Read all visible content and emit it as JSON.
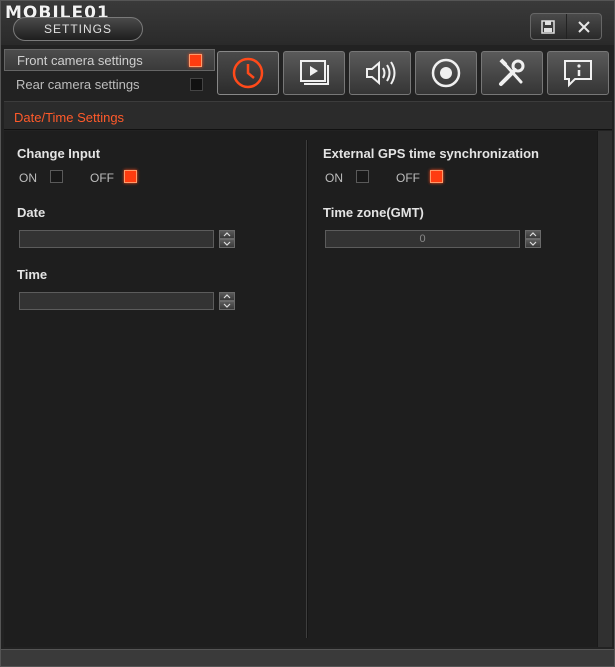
{
  "app": {
    "logo_text": "MOBILE01",
    "title": "SETTINGS"
  },
  "window_buttons": {
    "save_icon": "save-icon",
    "close_icon": "close-icon"
  },
  "cameras": [
    {
      "label": "Front camera settings",
      "selected": true
    },
    {
      "label": "Rear camera settings",
      "selected": false
    }
  ],
  "tabs": [
    {
      "icon": "clock-icon",
      "active": true
    },
    {
      "icon": "video-playback-icon",
      "active": false
    },
    {
      "icon": "speaker-icon",
      "active": false
    },
    {
      "icon": "record-icon",
      "active": false
    },
    {
      "icon": "tools-icon",
      "active": false
    },
    {
      "icon": "info-icon",
      "active": false
    }
  ],
  "section": {
    "title": "Date/Time Settings"
  },
  "left": {
    "change_input": {
      "label": "Change Input",
      "on_label": "ON",
      "off_label": "OFF",
      "value": "OFF"
    },
    "date": {
      "label": "Date",
      "value": ""
    },
    "time": {
      "label": "Time",
      "value": ""
    }
  },
  "right": {
    "gps_sync": {
      "label": "External GPS time synchronization",
      "on_label": "ON",
      "off_label": "OFF",
      "value": "OFF"
    },
    "timezone": {
      "label": "Time zone(GMT)",
      "value": "0"
    }
  },
  "colors": {
    "accent": "#ff3c10",
    "section_title": "#ff5a2a",
    "background": "#1e1e1e"
  }
}
